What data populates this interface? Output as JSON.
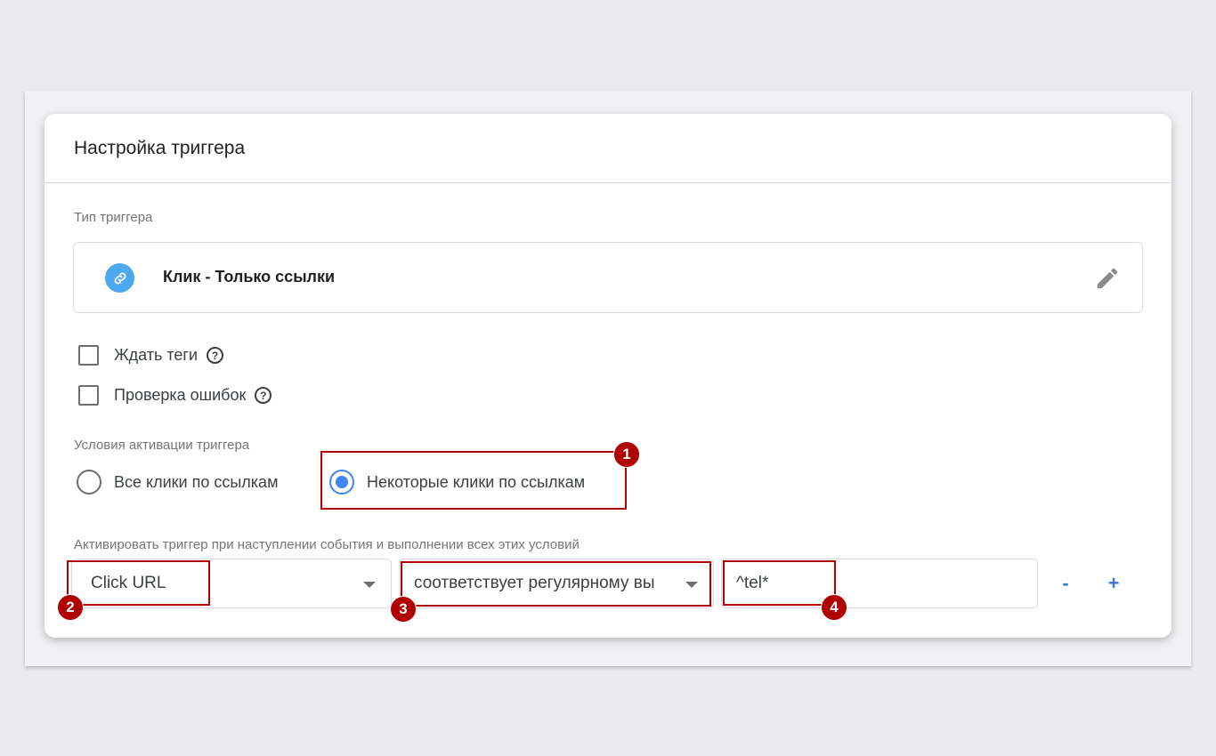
{
  "card": {
    "title": "Настройка триггера"
  },
  "trigger_type": {
    "label": "Тип триггера",
    "name": "Клик - Только ссылки",
    "icon": "link-icon",
    "edit_icon": "pencil-icon"
  },
  "options": [
    {
      "label": "Ждать теги",
      "checked": false,
      "help": "?"
    },
    {
      "label": "Проверка ошибок",
      "checked": false,
      "help": "?"
    }
  ],
  "activation": {
    "label": "Условия активации триггера",
    "radios": [
      {
        "label": "Все клики по ссылкам",
        "checked": false
      },
      {
        "label": "Некоторые клики по ссылкам",
        "checked": true
      }
    ]
  },
  "condition": {
    "label": "Активировать триггер при наступлении события и выполнении всех этих условий",
    "variable": "Click URL",
    "operator": "соответствует регулярному выражению",
    "value": "^tel*",
    "remove_label": "-",
    "add_label": "+"
  },
  "callouts": [
    "1",
    "2",
    "3",
    "4"
  ],
  "colors": {
    "accent": "#4285f4",
    "link_icon_bg": "#4ca9f0",
    "callout": "#b00000",
    "action_button": "#3d78d8"
  }
}
